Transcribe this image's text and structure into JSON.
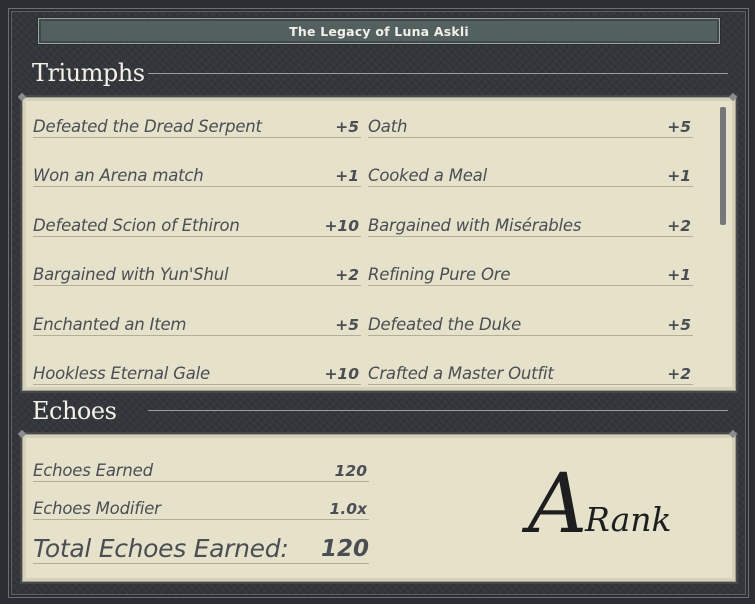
{
  "header": {
    "title": "The Legacy of Luna Askli"
  },
  "triumphs": {
    "heading": "Triumphs",
    "left": [
      {
        "label": "Defeated the Dread Serpent",
        "value": "+5"
      },
      {
        "label": "Won an Arena match",
        "value": "+1"
      },
      {
        "label": "Defeated Scion of Ethiron",
        "value": "+10"
      },
      {
        "label": "Bargained with Yun'Shul",
        "value": "+2"
      },
      {
        "label": "Enchanted an Item",
        "value": "+5"
      },
      {
        "label": "Hookless Eternal Gale",
        "value": "+10"
      }
    ],
    "right": [
      {
        "label": "Oath",
        "value": "+5"
      },
      {
        "label": "Cooked a Meal",
        "value": "+1"
      },
      {
        "label": "Bargained with Misérables",
        "value": "+2"
      },
      {
        "label": "Refining Pure Ore",
        "value": "+1"
      },
      {
        "label": "Defeated the Duke",
        "value": "+5"
      },
      {
        "label": "Crafted a Master Outfit",
        "value": "+2"
      }
    ]
  },
  "echoes": {
    "heading": "Echoes",
    "earned_label": "Echoes Earned",
    "earned_value": "120",
    "modifier_label": "Echoes Modifier",
    "modifier_value": "1.0x",
    "total_label": "Total Echoes Earned:",
    "total_value": "120"
  },
  "rank": {
    "letter": "A",
    "word": "Rank"
  },
  "colors": {
    "panel_bg": "#e5e2c9",
    "frame_bg": "#33363b",
    "title_bar": "#52605f",
    "text": "#4a4e55",
    "rank_text": "#1d1e20"
  }
}
